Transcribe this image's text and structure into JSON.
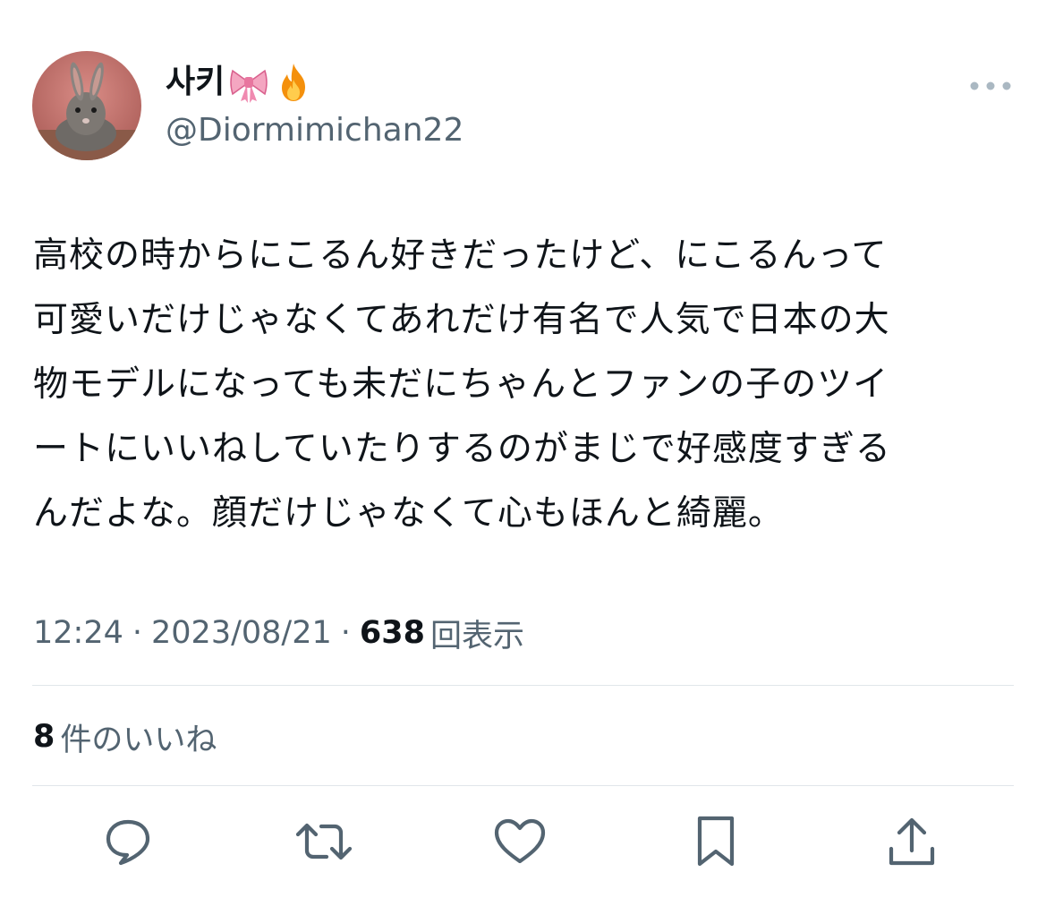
{
  "user": {
    "display_name": "사키",
    "emojis": [
      "ribbon-emoji",
      "fire-emoji"
    ],
    "handle": "@Diormimichan22",
    "avatar": "rabbit-photo"
  },
  "tweet": {
    "text": "高校の時からにこるん好きだったけど、にこるんって\n可愛いだけじゃなくてあれだけ有名で人気で日本の大\n物モデルになっても未だにちゃんとファンの子のツイ\nートにいいねしていたりするのがまじで好感度すぎる\nんだよな。顔だけじゃなくて心もほんと綺麗。",
    "time": "12:24",
    "separator": "·",
    "date": "2023/08/21",
    "views_count": "638",
    "views_label": "回表示",
    "likes_count": "8",
    "likes_label": "件のいいね"
  },
  "actions": [
    {
      "name": "reply",
      "icon": "reply-icon"
    },
    {
      "name": "retweet",
      "icon": "retweet-icon"
    },
    {
      "name": "like",
      "icon": "heart-icon"
    },
    {
      "name": "bookmark",
      "icon": "bookmark-icon"
    },
    {
      "name": "share",
      "icon": "share-icon"
    }
  ],
  "colors": {
    "text_primary": "#0f1419",
    "text_secondary": "#536471",
    "icon": "#536471",
    "divider": "#e1e6ea"
  }
}
